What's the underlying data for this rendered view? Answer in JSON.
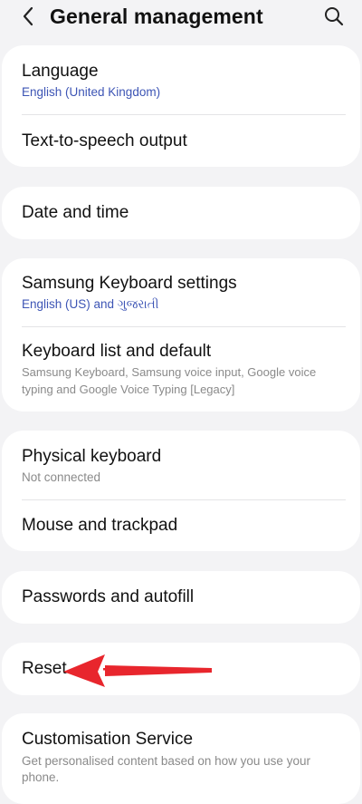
{
  "header": {
    "title": "General management",
    "back_icon": "chevron-left-icon",
    "search_icon": "search-icon"
  },
  "colors": {
    "background": "#f3f3f5",
    "card": "#ffffff",
    "subtitle_accent": "#3d55b5",
    "subtitle_gray": "#8a8a8a",
    "annotation_arrow": "#e8262d"
  },
  "items": {
    "language": {
      "title": "Language",
      "subtitle": "English (United Kingdom)"
    },
    "tts": {
      "title": "Text-to-speech output"
    },
    "datetime": {
      "title": "Date and time"
    },
    "samsung_keyboard": {
      "title": "Samsung Keyboard settings",
      "subtitle": "English (US) and ગુજરાતી"
    },
    "keyboard_list": {
      "title": "Keyboard list and default",
      "subtitle_line1": "Samsung Keyboard, Samsung voice input, Google voice",
      "subtitle_line2": "typing and Google Voice Typing [Legacy]"
    },
    "physical_keyboard": {
      "title": "Physical keyboard",
      "subtitle": "Not connected"
    },
    "mouse": {
      "title": "Mouse and trackpad"
    },
    "passwords": {
      "title": "Passwords and autofill"
    },
    "reset": {
      "title": "Reset"
    },
    "customisation": {
      "title": "Customisation Service",
      "subtitle_line1": "Get personalised content based on how you use your",
      "subtitle_line2": "phone."
    }
  },
  "annotation": {
    "icon": "red-arrow-pointing-left",
    "target": "Reset"
  }
}
